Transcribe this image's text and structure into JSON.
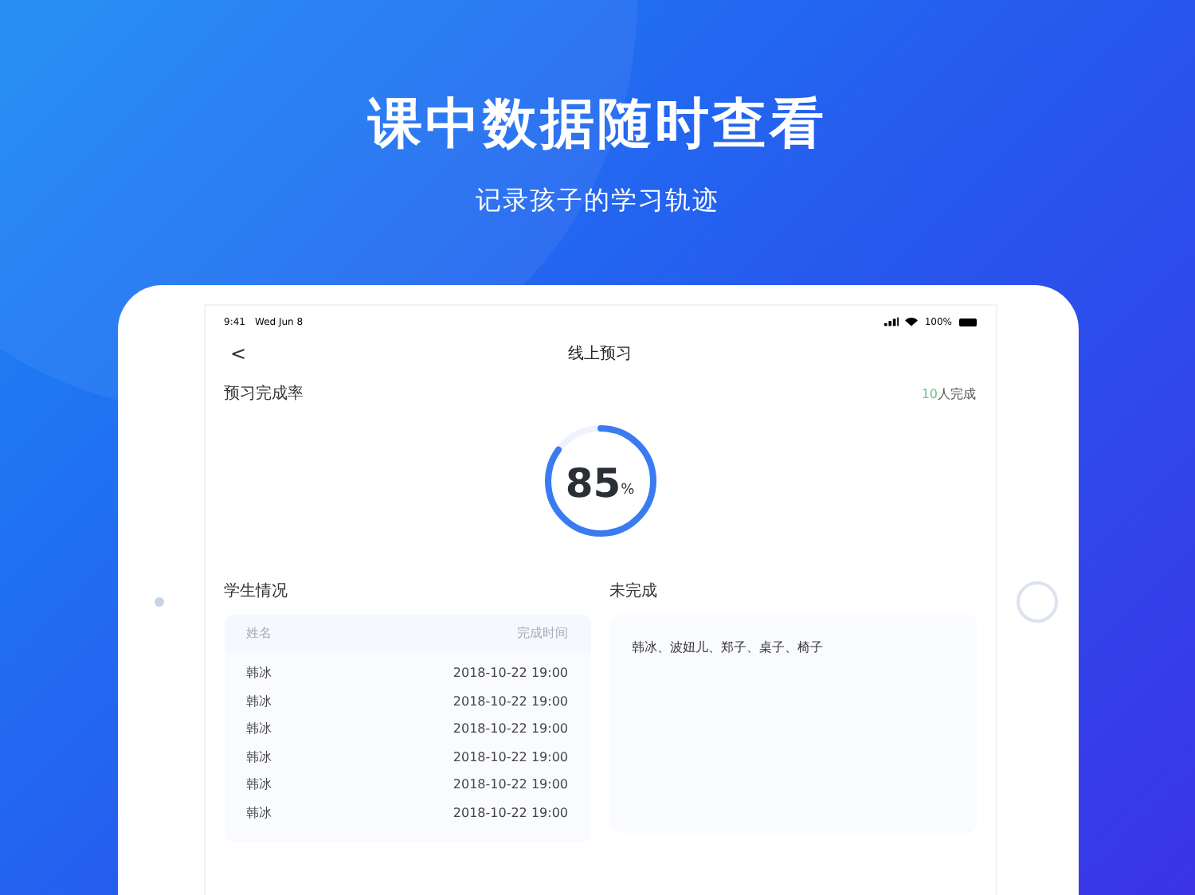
{
  "headline": "课中数据随时查看",
  "subheadline": "记录孩子的学习轨迹",
  "status_bar": {
    "time": "9:41",
    "date": "Wed Jun 8",
    "battery": "100%"
  },
  "nav": {
    "back": "<",
    "title": "线上预习"
  },
  "completion": {
    "title": "预习完成率",
    "count": "10",
    "count_label": "人完成",
    "value": "85",
    "unit": "%",
    "level": 0.85
  },
  "students": {
    "title": "学生情况",
    "columns": [
      "姓名",
      "完成时间"
    ],
    "rows": [
      [
        "韩冰",
        "2018-10-22 19:00"
      ],
      [
        "韩冰",
        "2018-10-22 19:00"
      ],
      [
        "韩冰",
        "2018-10-22 19:00"
      ],
      [
        "韩冰",
        "2018-10-22 19:00"
      ],
      [
        "韩冰",
        "2018-10-22 19:00"
      ],
      [
        "韩冰",
        "2018-10-22 19:00"
      ]
    ]
  },
  "incomplete": {
    "title": "未完成",
    "names": "韩冰、波妞儿、郑子、桌子、椅子"
  }
}
